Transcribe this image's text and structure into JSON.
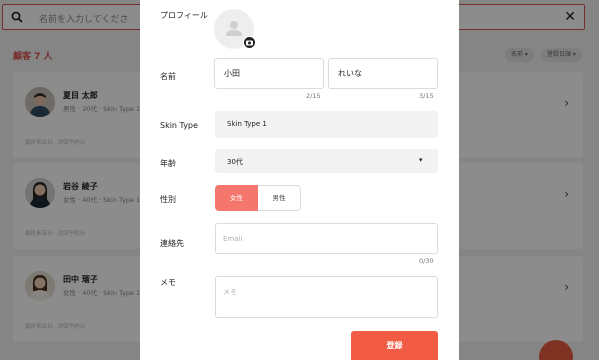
{
  "background": {
    "search": {
      "placeholder": "名前を入力してくださ"
    },
    "count_label": "顧客 7 人",
    "sort_chips": [
      "名前 ▾",
      "登録日順 ▾"
    ],
    "customers": [
      {
        "name": "夏目 太郎",
        "meta": "男性 · 20代 · Skin Type 1",
        "footer": "最終来店日 · 次回予約日"
      },
      {
        "name": "岩谷 綾子",
        "meta": "女性 · 40代 · Skin Type 1",
        "footer": "最終来店日 · 次回予約日"
      },
      {
        "name": "田中 瑠子",
        "meta": "女性 · 40代 · Skin Type 1",
        "footer": "最終来店日 · 次回予約日"
      }
    ]
  },
  "modal": {
    "profile_label": "プロフィール",
    "name_label": "名前",
    "last_name": "小田",
    "first_name": "れいな",
    "last_name_count": "2/15",
    "first_name_count": "3/15",
    "skin_type_label": "Skin Type",
    "skin_type_value": "Skin Type 1",
    "skin_swatch_color": "#e6c0ad",
    "age_label": "年齢",
    "age_value": "30代",
    "gender_label": "性別",
    "gender_options": [
      "女性",
      "男性"
    ],
    "gender_selected": "女性",
    "contact_label": "連絡先",
    "email_placeholder": "Email",
    "email_count": "0/30",
    "memo_label": "メモ",
    "memo_placeholder": "メモ",
    "submit_label": "登録",
    "accent_color": "#f25c44"
  }
}
